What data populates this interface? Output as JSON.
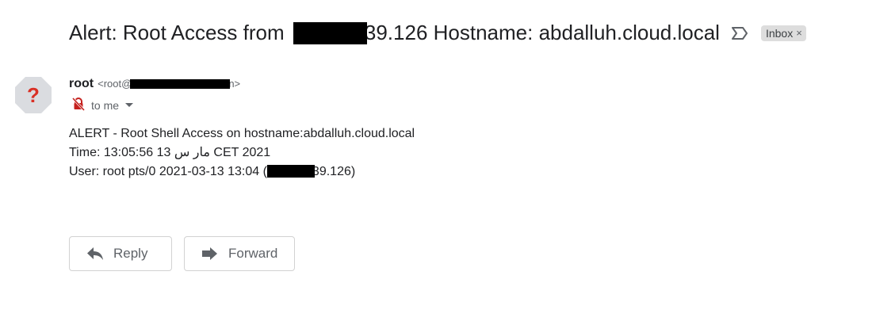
{
  "message": {
    "subject_prefix": "Alert: Root Access from ",
    "subject_suffix": "39.126 Hostname: abdalluh.cloud.local",
    "label": "Inbox",
    "label_remove": "×"
  },
  "sender": {
    "name": "root",
    "email_prefix": "<root@",
    "email_suffix": "n>",
    "to_label": "to me"
  },
  "body": {
    "line1": "ALERT - Root Shell Access on hostname:abdalluh.cloud.local",
    "line2": "Time:  13:05:56 13 مار س CET 2021",
    "line3_prefix": "User: root pts/0 2021-03-13 13:04 (",
    "line3_suffix": "39.126)"
  },
  "actions": {
    "reply": "Reply",
    "forward": "Forward"
  },
  "icons": {
    "avatar": "unknown-sender-icon",
    "importance": "importance-marker-icon",
    "security": "no-encryption-icon",
    "reply": "reply-arrow-icon",
    "forward": "forward-arrow-icon"
  },
  "colors": {
    "avatar_bg": "#dadce0",
    "avatar_mark": "#d93025",
    "label_bg": "#dddddd",
    "security_icon": "#c5221f"
  }
}
